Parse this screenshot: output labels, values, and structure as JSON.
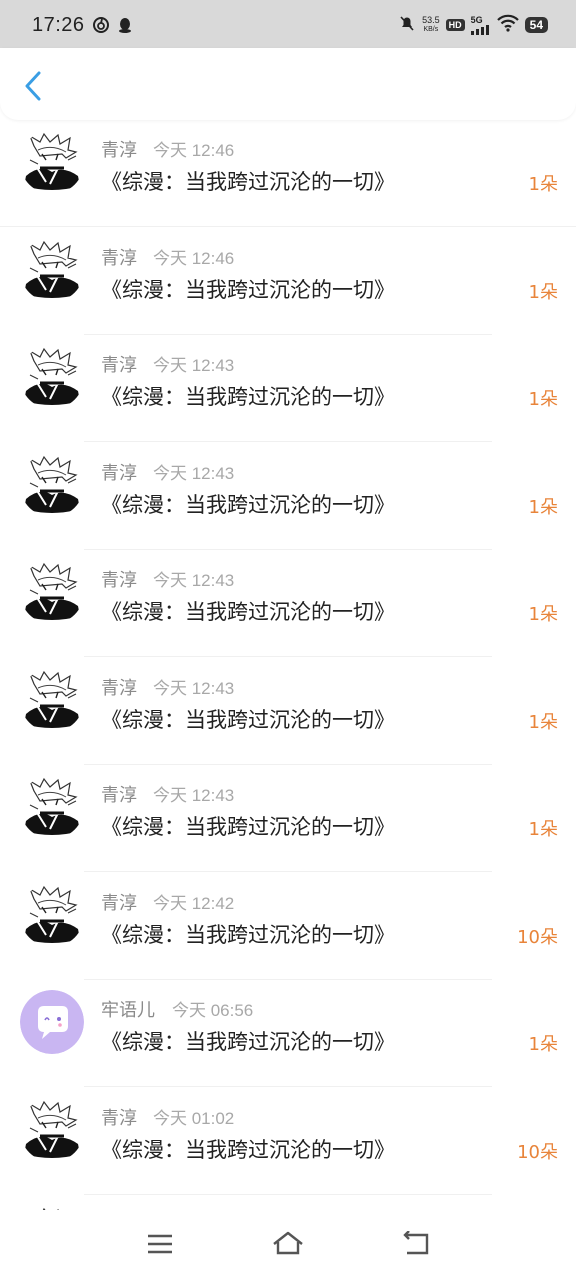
{
  "status_bar": {
    "time": "17:26",
    "left_icons": [
      "netease-cloud-music-icon",
      "qq-penguin-icon"
    ],
    "speed_value": "53.5",
    "speed_unit": "KB/s",
    "hd": "HD",
    "network": "5G",
    "battery": "54"
  },
  "header": {
    "back_icon": "chevron-left-icon"
  },
  "items": [
    {
      "name": "青淳",
      "time": "今天 12:46",
      "title": "《综漫：当我跨过沉沦的一切》",
      "count": "1朵",
      "avatar": "manga"
    },
    {
      "name": "青淳",
      "time": "今天 12:46",
      "title": "《综漫：当我跨过沉沦的一切》",
      "count": "1朵",
      "avatar": "manga"
    },
    {
      "name": "青淳",
      "time": "今天 12:43",
      "title": "《综漫：当我跨过沉沦的一切》",
      "count": "1朵",
      "avatar": "manga"
    },
    {
      "name": "青淳",
      "time": "今天 12:43",
      "title": "《综漫：当我跨过沉沦的一切》",
      "count": "1朵",
      "avatar": "manga"
    },
    {
      "name": "青淳",
      "time": "今天 12:43",
      "title": "《综漫：当我跨过沉沦的一切》",
      "count": "1朵",
      "avatar": "manga"
    },
    {
      "name": "青淳",
      "time": "今天 12:43",
      "title": "《综漫：当我跨过沉沦的一切》",
      "count": "1朵",
      "avatar": "manga"
    },
    {
      "name": "青淳",
      "time": "今天 12:43",
      "title": "《综漫：当我跨过沉沦的一切》",
      "count": "1朵",
      "avatar": "manga"
    },
    {
      "name": "青淳",
      "time": "今天 12:42",
      "title": "《综漫：当我跨过沉沦的一切》",
      "count": "10朵",
      "avatar": "manga"
    },
    {
      "name": "牢语儿",
      "time": "今天 06:56",
      "title": "《综漫：当我跨过沉沦的一切》",
      "count": "1朵",
      "avatar": "default"
    },
    {
      "name": "青淳",
      "time": "今天 01:02",
      "title": "《综漫：当我跨过沉沦的一切》",
      "count": "10朵",
      "avatar": "manga"
    }
  ],
  "nav": {
    "icons": [
      "menu-icon",
      "home-icon",
      "back-icon"
    ]
  },
  "colors": {
    "accent_blue": "#3a9ee4",
    "count_orange": "#e8843a",
    "default_avatar_bg": "#c9b6f2"
  }
}
